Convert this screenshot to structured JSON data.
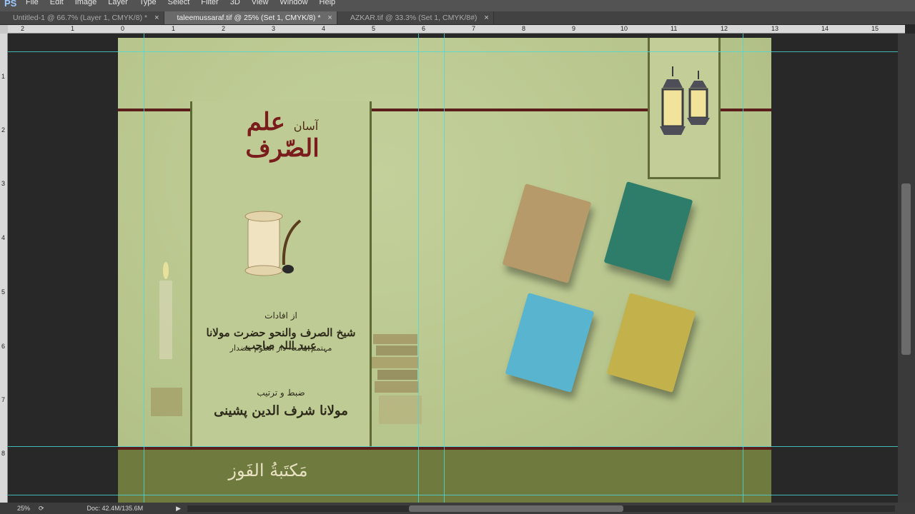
{
  "app": {
    "logo": "PS"
  },
  "menu": [
    "File",
    "Edit",
    "Image",
    "Layer",
    "Type",
    "Select",
    "Filter",
    "3D",
    "View",
    "Window",
    "Help"
  ],
  "tabs": [
    {
      "label": "Untitled-1 @ 66.7% (Layer 1, CMYK/8) *",
      "active": false
    },
    {
      "label": "taleemussaraf.tif @ 25% (Set 1, CMYK/8) *",
      "active": true
    },
    {
      "label": "AZKAR.tif @ 33.3% (Set 1, CMYK/8#)",
      "active": false
    }
  ],
  "ruler_top": [
    "2",
    "1",
    "0",
    "1",
    "2",
    "3",
    "4",
    "5",
    "6",
    "7",
    "8",
    "9",
    "10",
    "11",
    "12",
    "13",
    "14",
    "15"
  ],
  "ruler_left": [
    "1",
    "2",
    "3",
    "4",
    "5",
    "6",
    "7",
    "8"
  ],
  "cover": {
    "title_small": "آسان",
    "title_main": "علم الصّرف",
    "ifadat_label": "از افادات",
    "author_main": "شیخ الصرف والنحو حضرت مولانا عبید اللہ صاحب",
    "author_sub": "مہتمم جامعہ دار العلوم خضدار",
    "compiled_label": "ضبط و ترتیب",
    "compiler": "مولانا شرف الدین پشینی",
    "publisher": "مَكتَبةُ الفَوز"
  },
  "colors": {
    "maroon": "#5b1e1a",
    "canvas_bg": "#b9c891",
    "guide": "#4ad9d9"
  },
  "status": {
    "zoom": "25%",
    "doc": "Doc: 42.4M/135.6M"
  }
}
